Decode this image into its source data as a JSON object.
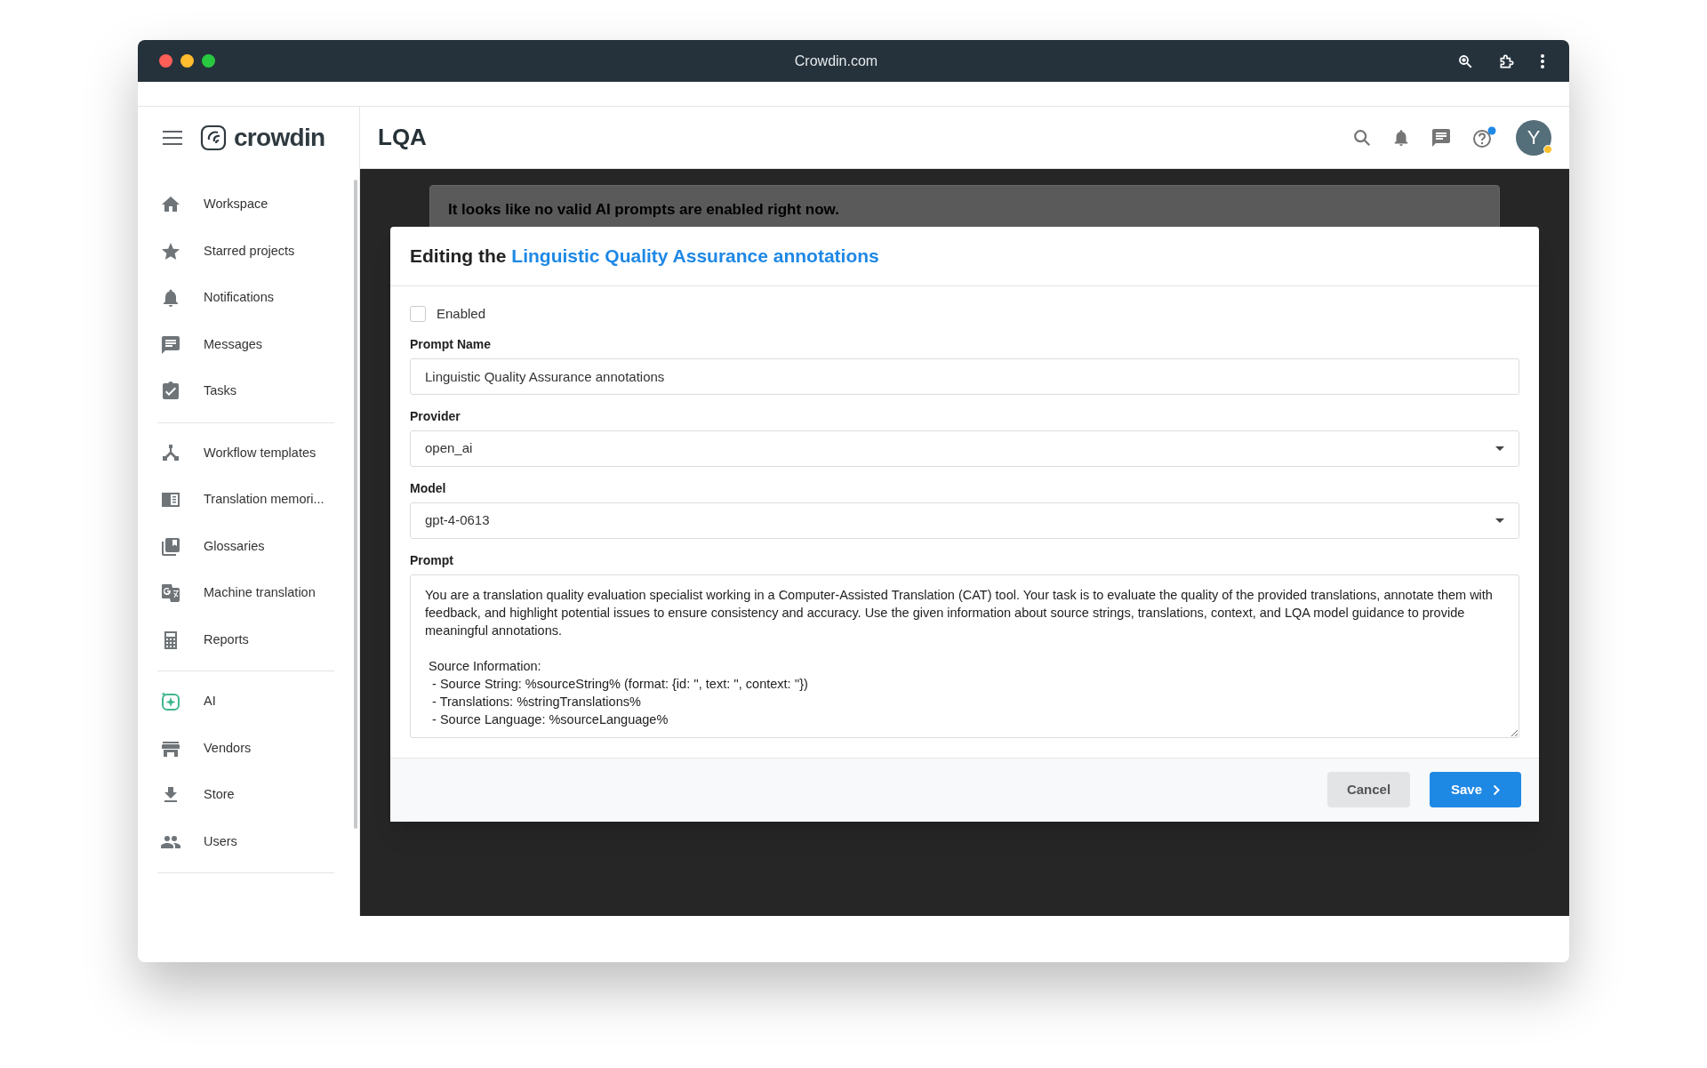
{
  "browser": {
    "title": "Crowdin.com"
  },
  "header": {
    "logo": "crowdin",
    "page_title": "LQA",
    "avatar": "Y"
  },
  "sidebar": {
    "groups": [
      [
        {
          "kind": "home",
          "label": "Workspace"
        },
        {
          "kind": "star",
          "label": "Starred projects"
        },
        {
          "kind": "bell",
          "label": "Notifications"
        },
        {
          "kind": "chat",
          "label": "Messages"
        },
        {
          "kind": "tasks",
          "label": "Tasks"
        }
      ],
      [
        {
          "kind": "workflow",
          "label": "Workflow templates"
        },
        {
          "kind": "memory",
          "label": "Translation memori..."
        },
        {
          "kind": "glossary",
          "label": "Glossaries"
        },
        {
          "kind": "translate",
          "label": "Machine translation"
        },
        {
          "kind": "calculator",
          "label": "Reports"
        }
      ],
      [
        {
          "kind": "ai",
          "label": "AI"
        },
        {
          "kind": "storefront",
          "label": "Vendors"
        },
        {
          "kind": "download",
          "label": "Store"
        },
        {
          "kind": "people",
          "label": "Users"
        }
      ]
    ]
  },
  "notice": {
    "title": "It looks like no valid AI prompts are enabled right now."
  },
  "dialog": {
    "title_prefix": "Editing the",
    "title_link": "Linguistic Quality Assurance annotations",
    "enabled": {
      "label": "Enabled",
      "checked": false
    },
    "fields": [
      {
        "kind": "text",
        "label": "Prompt Name",
        "value": "Linguistic Quality Assurance annotations"
      },
      {
        "kind": "select",
        "label": "Provider",
        "value": "open_ai"
      },
      {
        "kind": "select",
        "label": "Model",
        "value": "gpt-4-0613"
      },
      {
        "kind": "textarea",
        "label": "Prompt",
        "value": "You are a translation quality evaluation specialist working in a Computer-Assisted Translation (CAT) tool. Your task is to evaluate the quality of the provided translations, annotate them with feedback, and highlight potential issues to ensure consistency and accuracy. Use the given information about source strings, translations, context, and LQA model guidance to provide meaningful annotations.\n\n Source Information:\n  - Source String: %sourceString% (format: {id: '', text: '', context: ''})\n  - Translations: %stringTranslations%\n  - Source Language: %sourceLanguage%"
      }
    ],
    "buttons": [
      {
        "kind": "secondary",
        "label": "Cancel"
      },
      {
        "kind": "primary",
        "label": "Save"
      }
    ]
  }
}
